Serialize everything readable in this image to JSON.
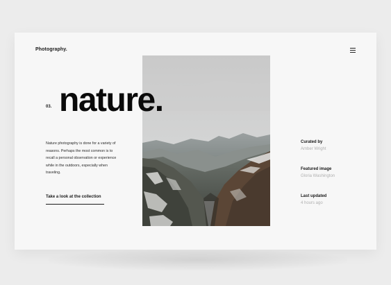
{
  "header": {
    "brand": "Photography.",
    "menu_icon": "hamburger-menu-icon"
  },
  "hero": {
    "index": "03.",
    "title": "nature.",
    "description": "Nature photography is done for a variety of reasons. Perhaps the most common is to recall a personal observation or experience while in the outdoors, especially when traveling.",
    "cta_label": "Take a look at the collection"
  },
  "meta": [
    {
      "label": "Curated by",
      "value": "Amber Wright"
    },
    {
      "label": "Featured image",
      "value": "Gloria Washington"
    },
    {
      "label": "Last updated",
      "value": "4 hours ago"
    }
  ],
  "colors": {
    "background": "#ececec",
    "card": "#f7f7f7",
    "text": "#0a0a0a",
    "muted": "#b0b0b0"
  }
}
